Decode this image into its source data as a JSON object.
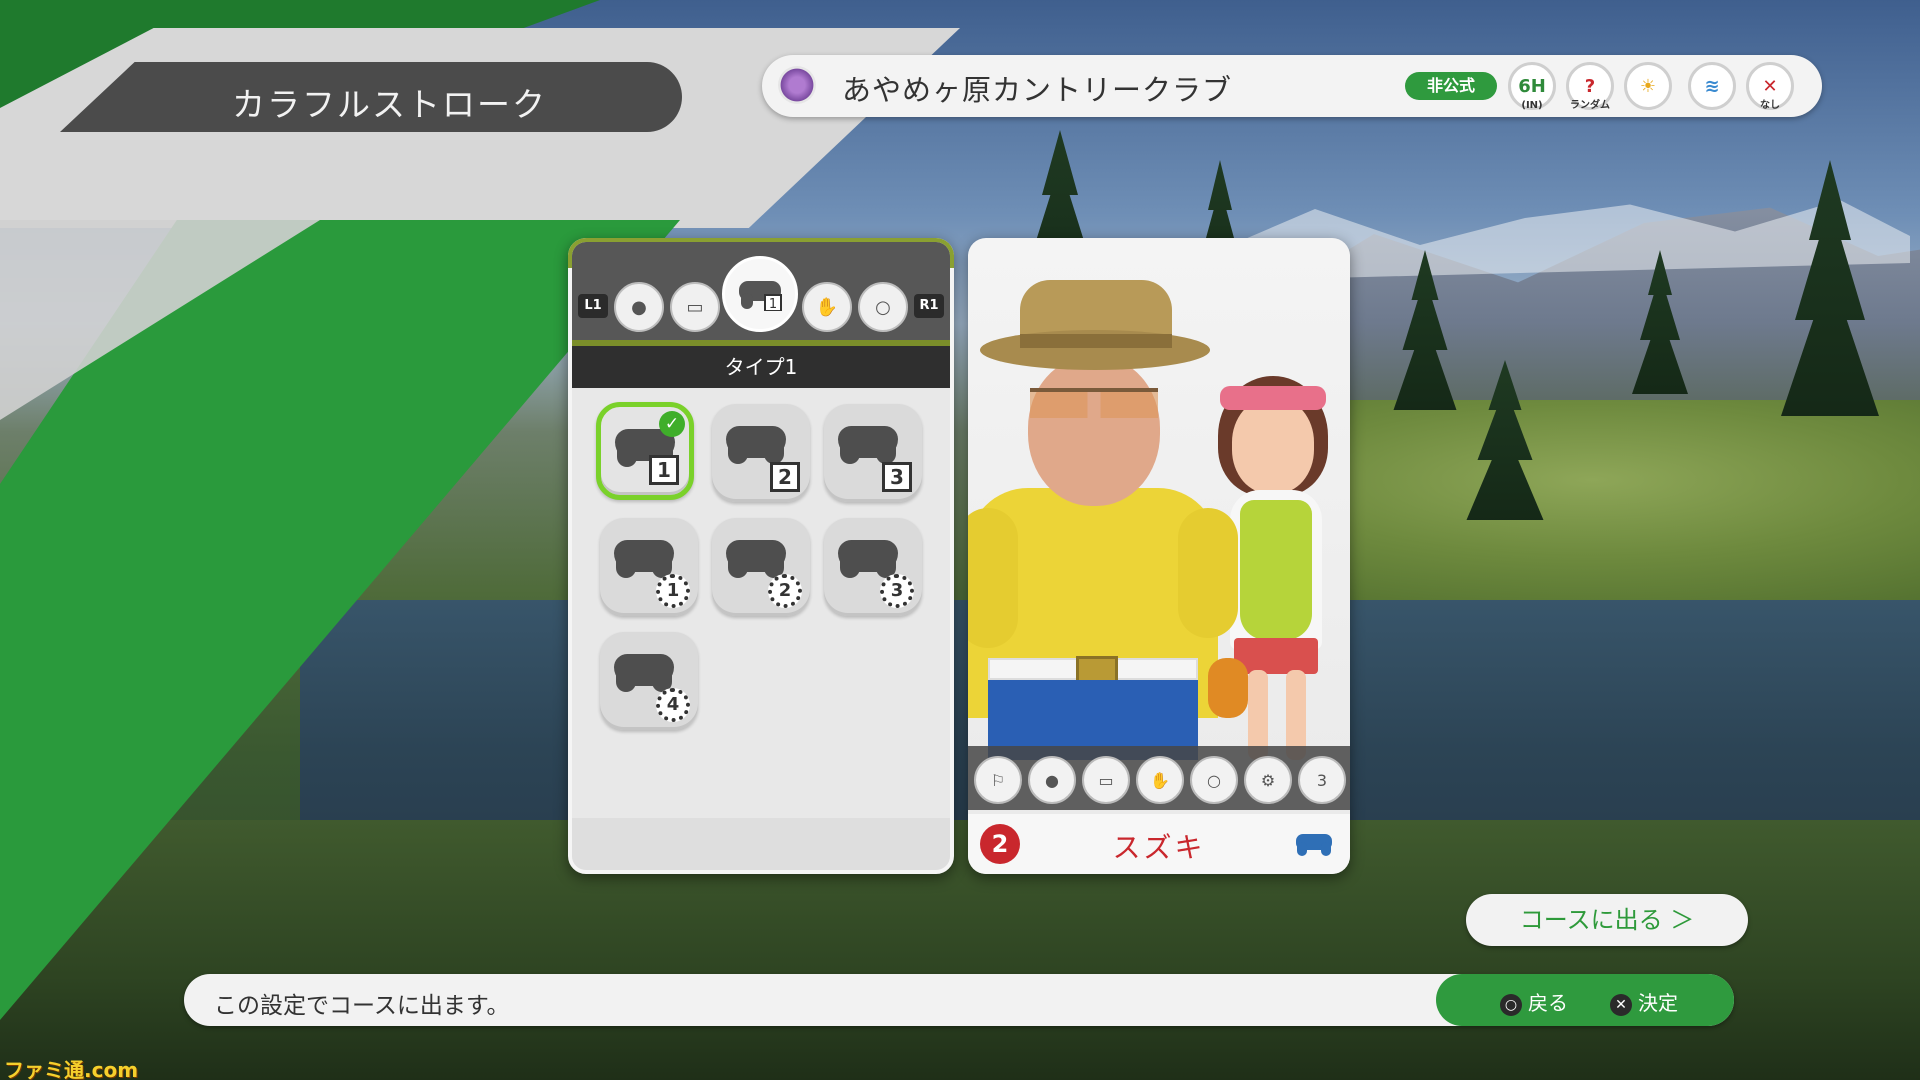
{
  "header": {
    "mode_title": "カラフルストローク",
    "course_name": "あやめヶ原カントリークラブ",
    "badge": "非公式",
    "options": [
      {
        "icon": "holes-6h-icon",
        "label": "6H",
        "sub": "(IN)"
      },
      {
        "icon": "random-question-icon",
        "label": "?",
        "sub": "ランダム"
      },
      {
        "icon": "weather-sun-icon",
        "label": "☀",
        "sub": ""
      },
      {
        "icon": "wind-icon",
        "label": "≋",
        "sub": ""
      },
      {
        "icon": "close-x-icon",
        "label": "✕",
        "sub": "なし"
      }
    ]
  },
  "settings_panel": {
    "left_shoulder": "L1",
    "right_shoulder": "R1",
    "categories": [
      {
        "icon": "ball-icon",
        "active": false
      },
      {
        "icon": "tee-icon",
        "active": false
      },
      {
        "icon": "controller-type-icon",
        "active": true,
        "badge": "1"
      },
      {
        "icon": "glove-icon",
        "active": false
      },
      {
        "icon": "speech-bubble-icon",
        "active": false
      }
    ],
    "selected_label": "タイプ1",
    "types": [
      {
        "num": "1",
        "style": "square",
        "selected": true
      },
      {
        "num": "2",
        "style": "square",
        "selected": false
      },
      {
        "num": "3",
        "style": "square",
        "selected": false
      },
      {
        "num": "1",
        "style": "gear",
        "selected": false
      },
      {
        "num": "2",
        "style": "gear",
        "selected": false
      },
      {
        "num": "3",
        "style": "gear",
        "selected": false
      },
      {
        "num": "4",
        "style": "gear",
        "selected": false
      }
    ]
  },
  "character": {
    "player_number": "2",
    "name": "スズキ",
    "equipment": [
      "club-icon",
      "ball-icon",
      "tee-icon",
      "glove-icon",
      "speech-bubble-icon",
      "gear-icon",
      "controller-type-3-icon"
    ],
    "equipment_badge": "3"
  },
  "footer": {
    "go_course_label": "コースに出る ＞",
    "message": "この設定でコースに出ます。",
    "back_label": "戻る",
    "confirm_label": "決定",
    "back_glyph": "○",
    "confirm_glyph": "✕"
  },
  "watermark": "ファミ通.com"
}
